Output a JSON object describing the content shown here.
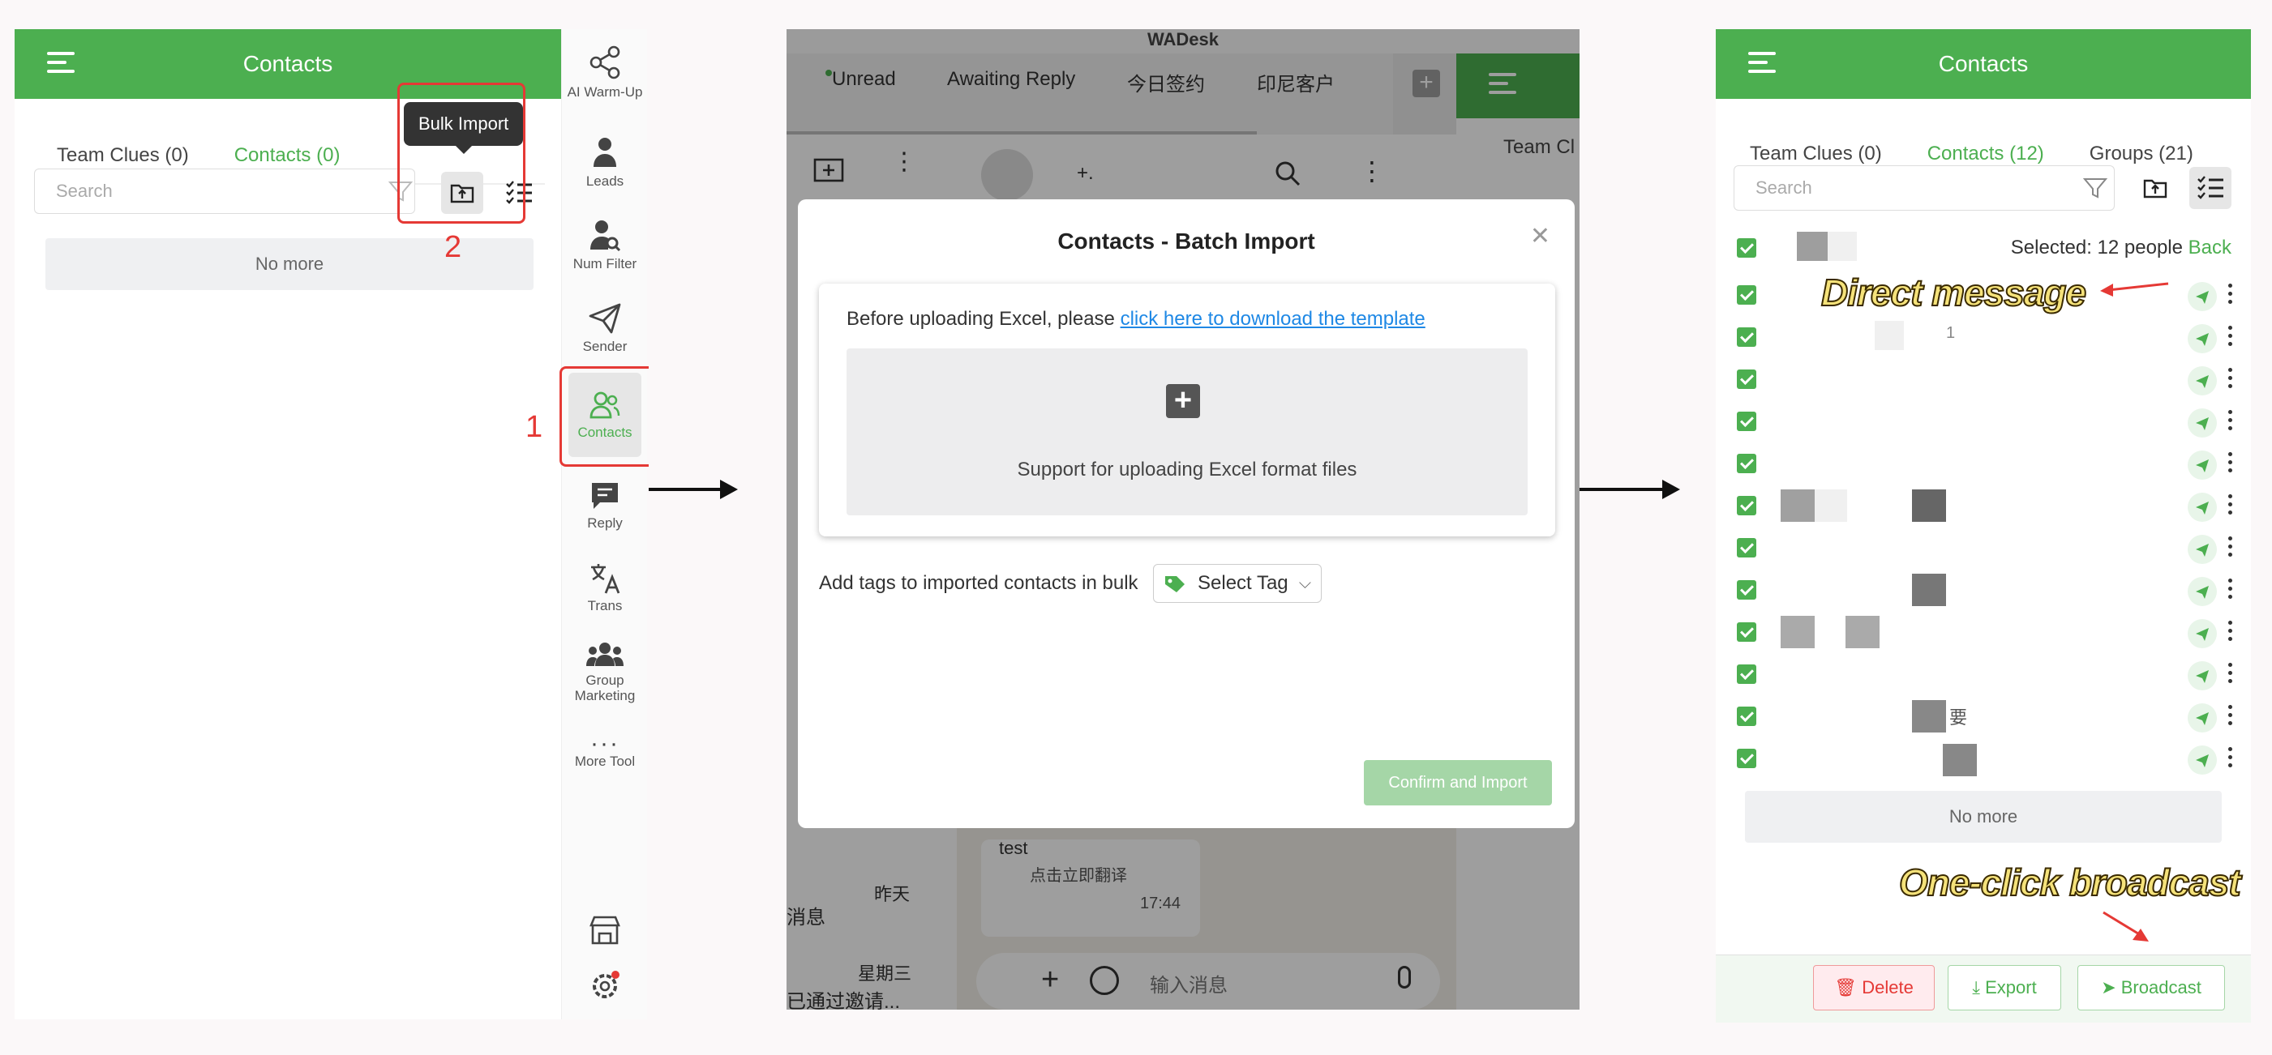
{
  "panel1": {
    "title": "Contacts",
    "tabs": [
      {
        "label": "Team Clues (0)"
      },
      {
        "label": "Contacts (0)"
      }
    ],
    "search_placeholder": "Search",
    "no_more": "No more",
    "tooltip": "Bulk Import",
    "step1": "1",
    "step2": "2"
  },
  "sidebar": {
    "items": [
      {
        "label": "AI Warm-Up",
        "icon": "share-icon"
      },
      {
        "label": "Leads",
        "icon": "person-icon"
      },
      {
        "label": "Num Filter",
        "icon": "person-search-icon"
      },
      {
        "label": "Sender",
        "icon": "send-icon"
      },
      {
        "label": "Contacts",
        "icon": "contacts-icon"
      },
      {
        "label": "Reply",
        "icon": "chat-icon"
      },
      {
        "label": "Trans",
        "icon": "translate-icon"
      },
      {
        "label": "Group Marketing",
        "icon": "group-icon"
      },
      {
        "label": "More Tool",
        "icon": "more-icon"
      }
    ]
  },
  "panel2": {
    "app_title": "WADesk",
    "chat_tabs": [
      "Unread",
      "Awaiting Reply",
      "今日签约",
      "印尼客户"
    ],
    "right_header": "Team Cl",
    "modal": {
      "title": "Contacts - Batch Import",
      "instruction": "Before uploading Excel, please ",
      "template_link": "click here to download the template",
      "upload_hint": "Support for uploading Excel format files",
      "tags_label": "Add tags to imported contacts in bulk",
      "select_tag": "Select Tag",
      "confirm": "Confirm and Import"
    },
    "bg": {
      "yesterday": "昨天",
      "wednesday": "星期三",
      "msg_snip": "消息",
      "invite_snip": "已通过邀请...",
      "test": "test",
      "translate": "点击立即翻译",
      "time": "17:44",
      "input_placeholder": "输入消息"
    }
  },
  "panel3": {
    "title": "Contacts",
    "tabs": [
      {
        "label": "Team Clues (0)"
      },
      {
        "label": "Contacts (12)"
      },
      {
        "label": "Groups (21)"
      }
    ],
    "search_placeholder": "Search",
    "selected": "Selected: 12 people",
    "back": "Back",
    "row_snippets": {
      "r3": "1",
      "r13": "要"
    },
    "no_more": "No more",
    "annot_direct": "Direct message",
    "annot_broadcast": "One-click broadcast",
    "delete": "Delete",
    "export": "Export",
    "broadcast": "Broadcast"
  },
  "colors": {
    "accent": "#4caf50",
    "highlight": "#e53935"
  }
}
